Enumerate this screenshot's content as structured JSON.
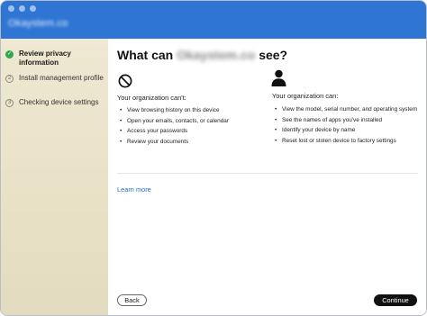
{
  "window": {
    "title": "Okaystem.co",
    "accent_color": "#2f76d4"
  },
  "sidebar": {
    "steps": [
      {
        "label": "Review privacy information",
        "status": "complete",
        "badge": "✓"
      },
      {
        "label": "Install management profile",
        "status": "pending",
        "badge": "2"
      },
      {
        "label": "Checking device settings",
        "status": "pending",
        "badge": "3"
      }
    ]
  },
  "main": {
    "heading_prefix": "What can",
    "heading_org": "Okaystem.co",
    "heading_suffix": "see?",
    "cant": {
      "icon": "prohibit-icon",
      "heading": "Your organization can't:",
      "items": [
        "View browsing history on this device",
        "Open your emails, contacts, or calendar",
        "Access your passwords",
        "Review your documents"
      ]
    },
    "can": {
      "icon": "person-icon",
      "heading": "Your organization can:",
      "items": [
        "View the model, serial number, and operating system",
        "See the names of apps you've installed",
        "Identify your device by name",
        "Reset lost or stolen device to factory settings"
      ]
    },
    "learn_more": "Learn more"
  },
  "footer": {
    "back_label": "Back",
    "continue_label": "Continue"
  }
}
